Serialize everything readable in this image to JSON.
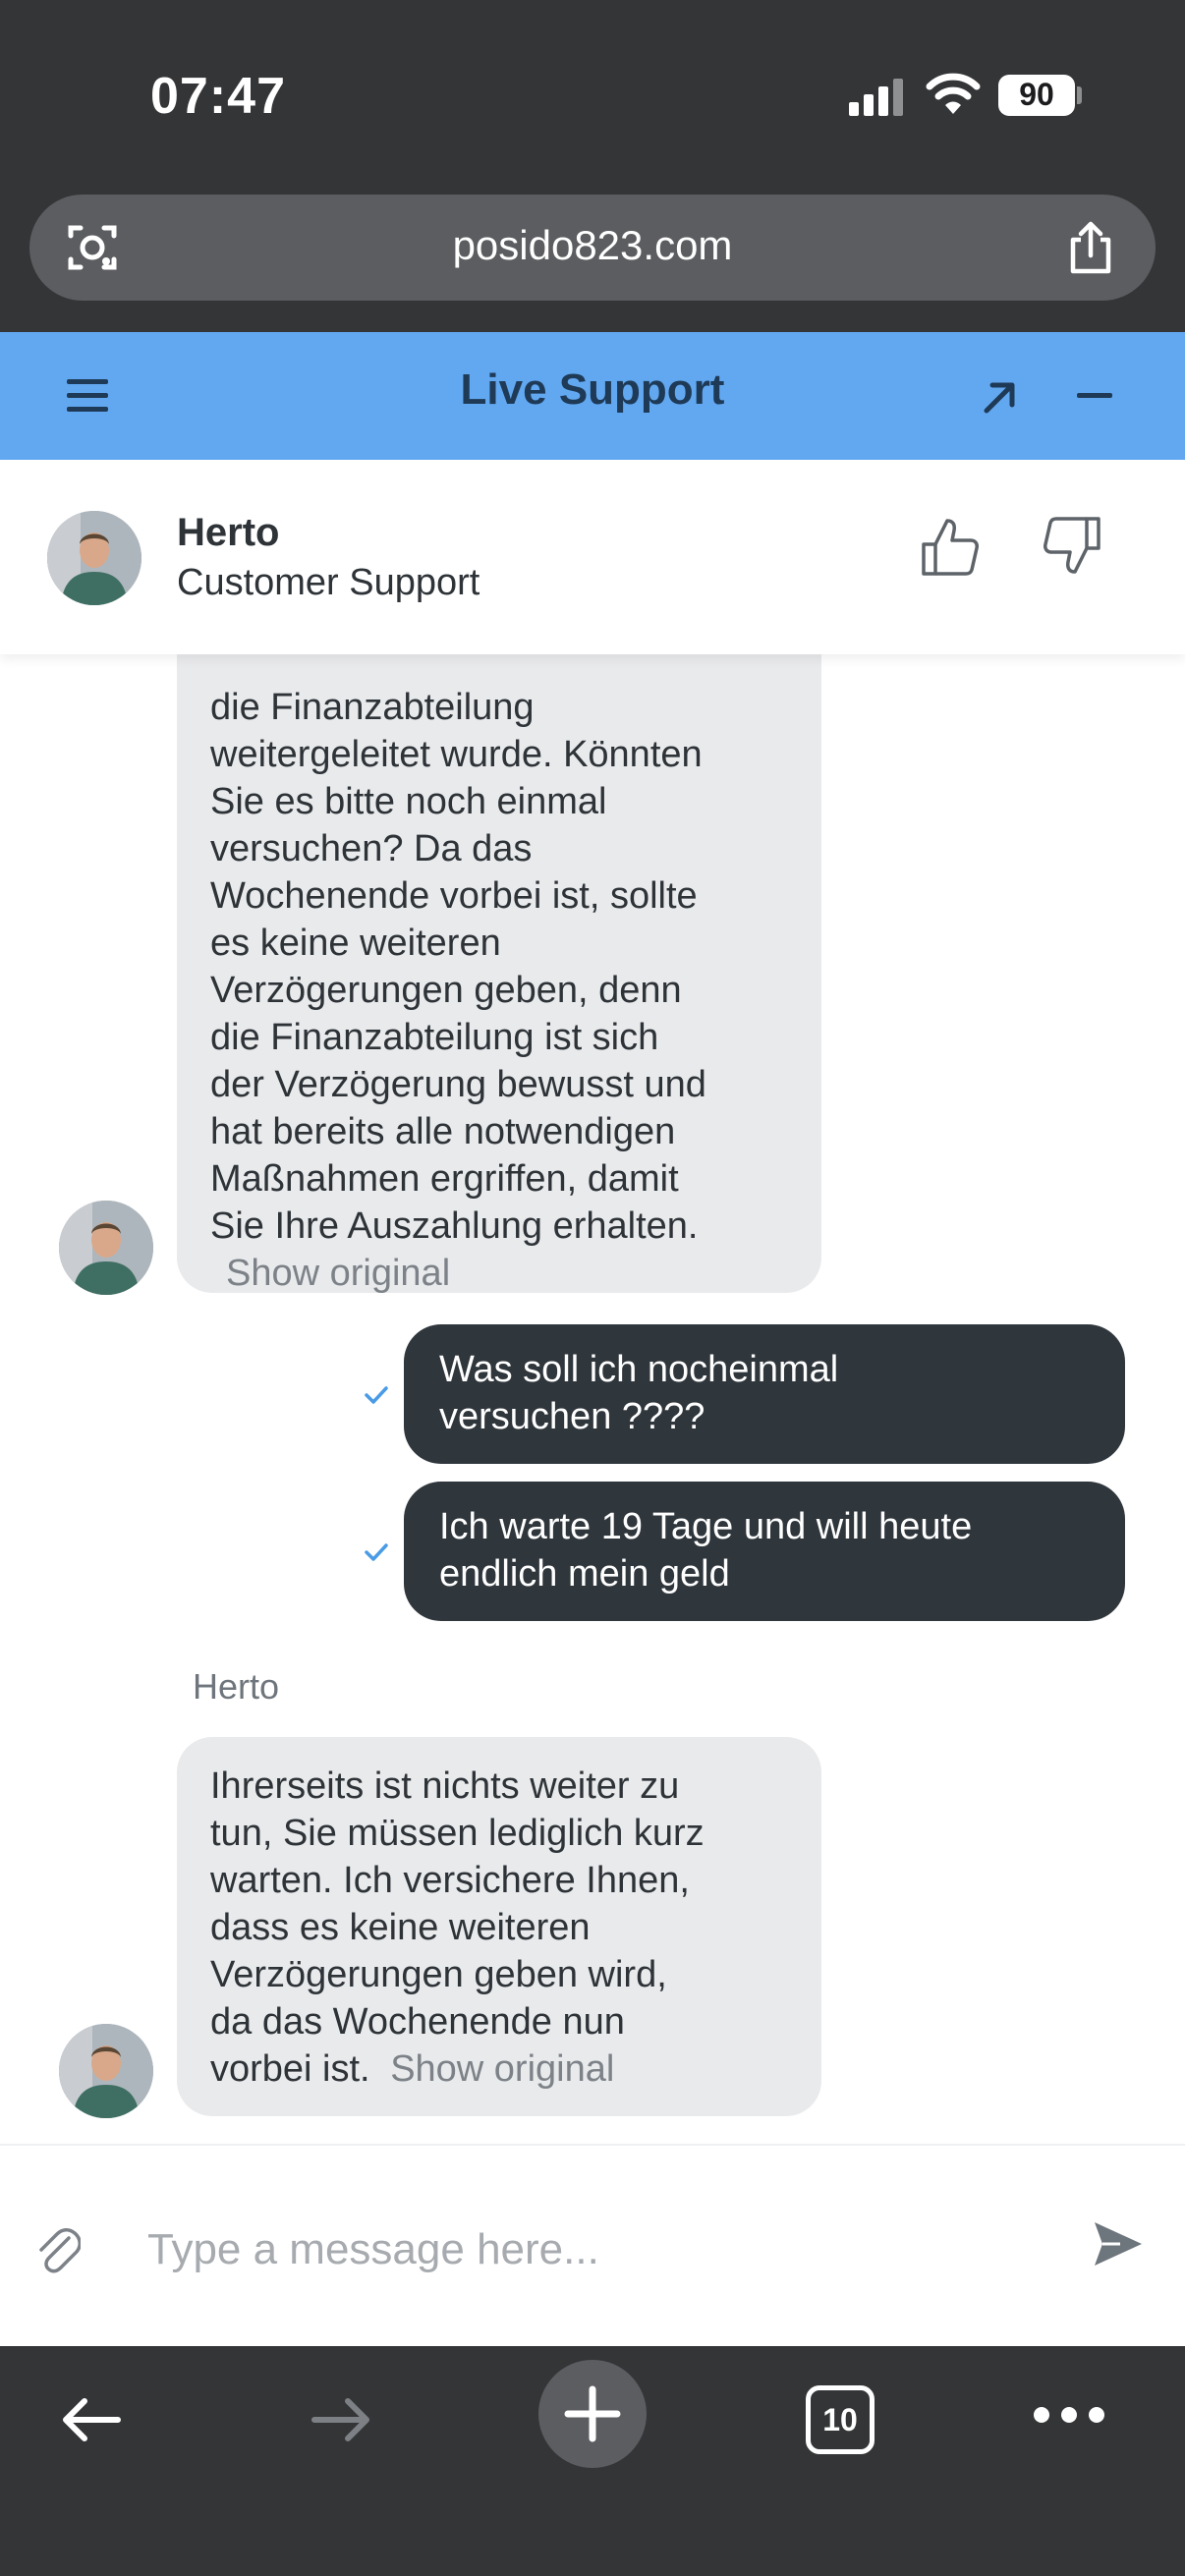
{
  "status_bar": {
    "time": "07:47",
    "battery": "90"
  },
  "browser": {
    "url": "posido823.com",
    "tab_count": "10"
  },
  "widget": {
    "title": "Live Support"
  },
  "agent": {
    "name": "Herto",
    "role": "Customer Support"
  },
  "messages": [
    {
      "direction": "in",
      "lines": [
        "die Finanzabteilung",
        "weitergeleitet wurde. Könnten",
        "Sie es bitte noch einmal",
        "versuchen? Da das",
        "Wochenende vorbei ist, sollte",
        "es keine weiteren",
        "Verzögerungen geben, denn",
        "die Finanzabteilung ist sich",
        "der Verzögerung bewusst und",
        "hat bereits alle notwendigen",
        "Maßnahmen ergriffen, damit",
        "Sie Ihre Auszahlung erhalten."
      ],
      "show_original": "Show original"
    },
    {
      "direction": "out",
      "lines": [
        "Was soll ich nocheinmal",
        "versuchen ????"
      ]
    },
    {
      "direction": "out",
      "lines": [
        "Ich warte 19 Tage und will heute",
        "endlich mein geld"
      ]
    },
    {
      "direction": "in",
      "sender": "Herto",
      "lines": [
        "Ihrerseits ist nichts weiter zu",
        "tun, Sie müssen lediglich kurz",
        "warten. Ich versichere Ihnen,",
        "dass es keine weiteren",
        "Verzögerungen geben wird,",
        "da das Wochenende nun",
        "vorbei ist."
      ],
      "show_original": "Show original"
    }
  ],
  "composer": {
    "placeholder": "Type a message here..."
  },
  "colors": {
    "header": "#62a8f1",
    "outgoing_bubble": "#2f363c",
    "incoming_bubble": "#e9eaec",
    "check": "#4a9be6"
  }
}
